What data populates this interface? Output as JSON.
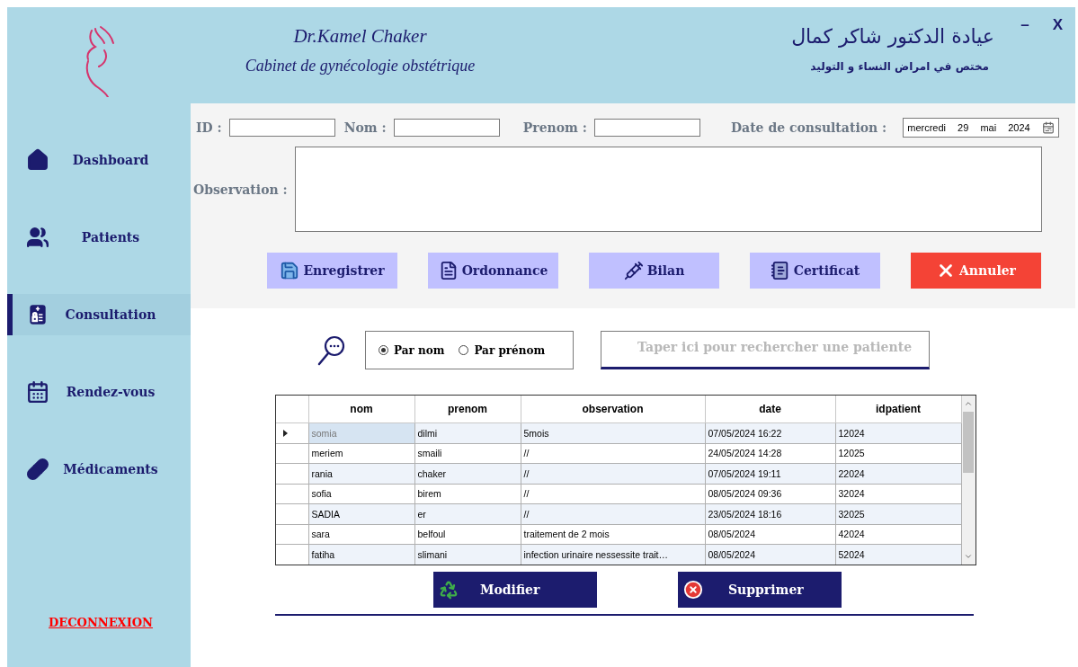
{
  "header": {
    "title": "Dr.Kamel Chaker",
    "subtitle": "Cabinet de gynécologie obstétrique",
    "arabic_title": "عيادة الدكتور شاكر كمال",
    "arabic_subtitle": "مختص في امراض النساء و التوليد"
  },
  "window_controls": [
    "–",
    "X"
  ],
  "sidebar": {
    "items": [
      {
        "label": "Dashboard",
        "selected": false
      },
      {
        "label": "Patients",
        "selected": false
      },
      {
        "label": "Consultation",
        "selected": true
      },
      {
        "label": "Rendez-vous",
        "selected": false
      },
      {
        "label": "Médicaments",
        "selected": false
      }
    ],
    "logout": "DECONNEXION"
  },
  "form": {
    "fields": [
      {
        "label": "ID :"
      },
      {
        "label": "Nom :"
      },
      {
        "label": "Prenom :"
      }
    ],
    "date": {
      "label": "Date de consultation :",
      "value": "mercredi 29 mai 2024"
    },
    "observation": {
      "label": "Observation :"
    },
    "actions": [
      {
        "label": "Enregistrer",
        "kind": "normal"
      },
      {
        "label": "Ordonnance",
        "kind": "normal"
      },
      {
        "label": "Bilan",
        "kind": "normal"
      },
      {
        "label": "Certificat",
        "kind": "normal"
      },
      {
        "label": "Annuler",
        "kind": "danger"
      }
    ]
  },
  "search": {
    "options": [
      {
        "label": "Par nom",
        "selected": true
      },
      {
        "label": "Par prénom",
        "selected": false
      }
    ],
    "placeholder": "Taper ici pour rechercher une patiente"
  },
  "table": {
    "columns": [
      "nom",
      "prenom",
      "observation",
      "date",
      "idpatient"
    ],
    "rows": [
      {
        "selected": true,
        "cells": [
          "somia",
          "dilmi",
          "5mois",
          "07/05/2024 16:22",
          "12024"
        ]
      },
      {
        "selected": false,
        "cells": [
          "meriem",
          "smaili",
          "//",
          "24/05/2024 14:28",
          "12025"
        ]
      },
      {
        "selected": false,
        "cells": [
          "rania",
          "chaker",
          "//",
          "07/05/2024 19:11",
          "22024"
        ]
      },
      {
        "selected": false,
        "cells": [
          "sofia",
          "birem",
          "//",
          "08/05/2024 09:36",
          "32024"
        ]
      },
      {
        "selected": false,
        "cells": [
          "SADIA",
          "er",
          "//",
          "23/05/2024 18:16",
          "32025"
        ]
      },
      {
        "selected": false,
        "cells": [
          "sara",
          "belfoul",
          "traitement de 2 mois",
          "08/05/2024",
          "42024"
        ]
      },
      {
        "selected": false,
        "cells": [
          "fatiha",
          "slimani",
          "infection urinaire nessessite trait…",
          "08/05/2024",
          "52024"
        ]
      }
    ]
  },
  "bottom_actions": [
    {
      "label": "Modifier"
    },
    {
      "label": "Supprimer"
    }
  ]
}
